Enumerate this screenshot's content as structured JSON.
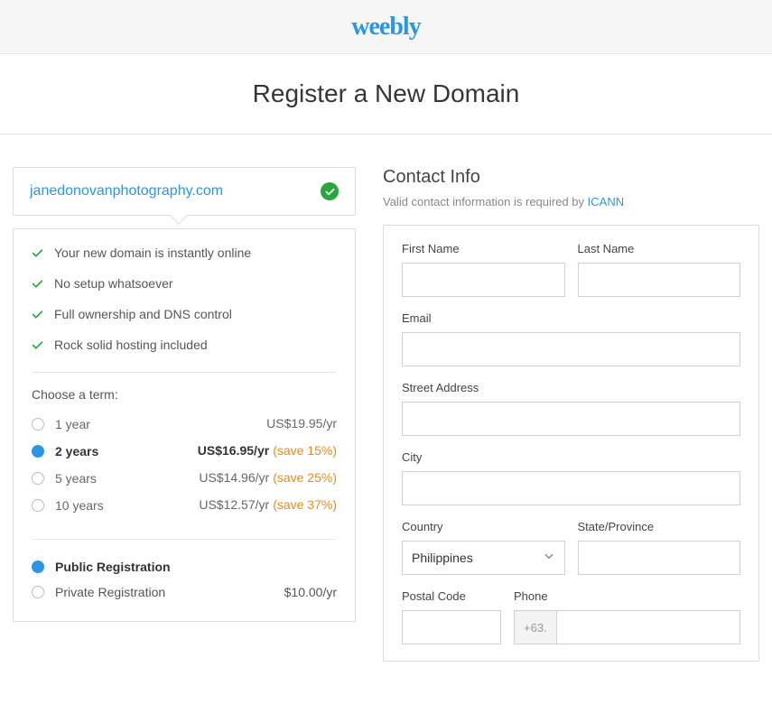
{
  "brand": "weebly",
  "page_title": "Register a New Domain",
  "domain": "janedonovanphotography.com",
  "features": [
    "Your new domain is instantly online",
    "No setup whatsoever",
    "Full ownership and DNS control",
    "Rock solid hosting included"
  ],
  "choose_term_label": "Choose a term:",
  "terms": [
    {
      "label": "1 year",
      "price": "US$19.95/yr",
      "save": "",
      "selected": false
    },
    {
      "label": "2 years",
      "price": "US$16.95/yr",
      "save": "(save 15%)",
      "selected": true
    },
    {
      "label": "5 years",
      "price": "US$14.96/yr",
      "save": "(save 25%)",
      "selected": false
    },
    {
      "label": "10 years",
      "price": "US$12.57/yr",
      "save": "(save 37%)",
      "selected": false
    }
  ],
  "registration": [
    {
      "label": "Public Registration",
      "price": "",
      "selected": true
    },
    {
      "label": "Private Registration",
      "price": "$10.00/yr",
      "selected": false
    }
  ],
  "contact": {
    "title": "Contact Info",
    "subtext": "Valid contact information is required by ",
    "subtext_link": "ICANN",
    "labels": {
      "first_name": "First Name",
      "last_name": "Last Name",
      "email": "Email",
      "street": "Street Address",
      "city": "City",
      "country": "Country",
      "state": "State/Province",
      "postal": "Postal Code",
      "phone": "Phone"
    },
    "values": {
      "first_name": "",
      "last_name": "",
      "email": "",
      "street": "",
      "city": "",
      "country": "Philippines",
      "state": "",
      "postal": "",
      "phone_prefix": "+63.",
      "phone": ""
    }
  }
}
